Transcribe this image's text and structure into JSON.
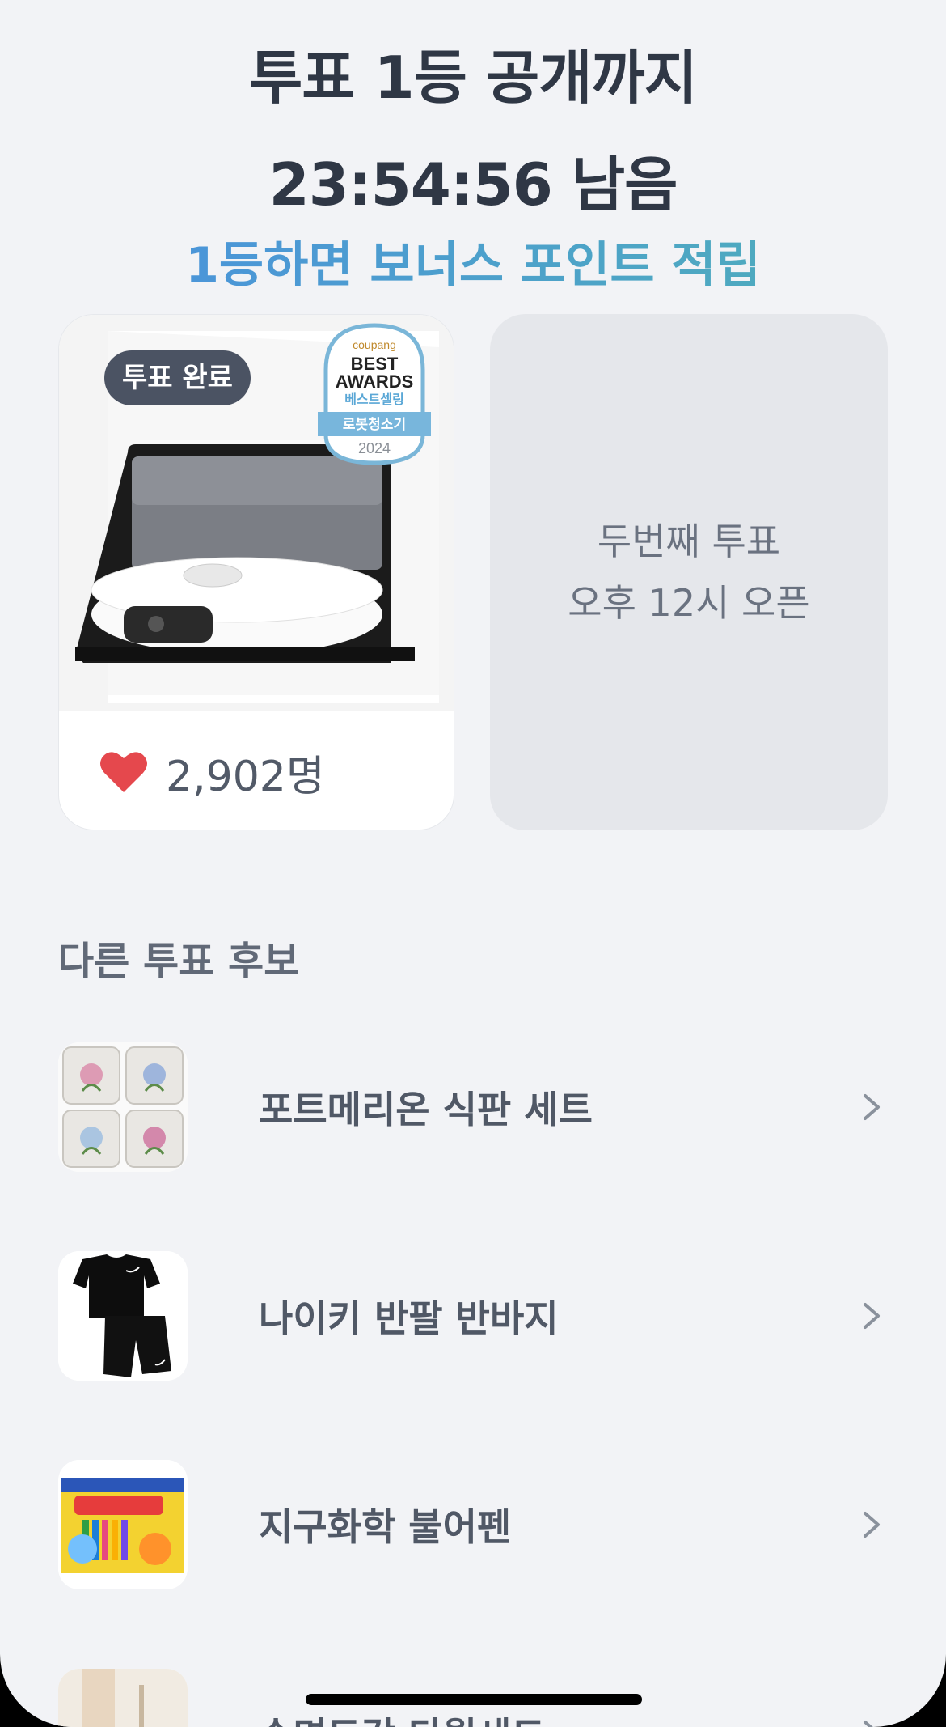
{
  "hero": {
    "line1": "투표 1등 공개까지",
    "line2": "23:54:56 남음",
    "subtitle": "1등하면 보너스 포인트 적립"
  },
  "voted_card": {
    "badge": "투표 완료",
    "award": {
      "brand": "coupang",
      "title_line1": "BEST",
      "title_line2": "AWARDS",
      "subtitle": "베스트셀링",
      "category": "로봇청소기",
      "year": "2024"
    },
    "like_count": "2,902명"
  },
  "second_card": {
    "line1": "두번째 투표",
    "line2": "오후 12시 오픈"
  },
  "section_title": "다른 투표 후보",
  "items": [
    {
      "label": "포트메리온 식판 세트",
      "thumb": "dish-set"
    },
    {
      "label": "나이키 반팔 반바지",
      "thumb": "nike-outfit"
    },
    {
      "label": "지구화학 불어펜",
      "thumb": "blow-pen"
    },
    {
      "label": "순면도각 타월세트",
      "thumb": "towel"
    }
  ],
  "colors": {
    "accent_start": "#4a8fe0",
    "accent_end": "#4fb0b8",
    "heart": "#e5484d",
    "background": "#f2f3f6"
  }
}
